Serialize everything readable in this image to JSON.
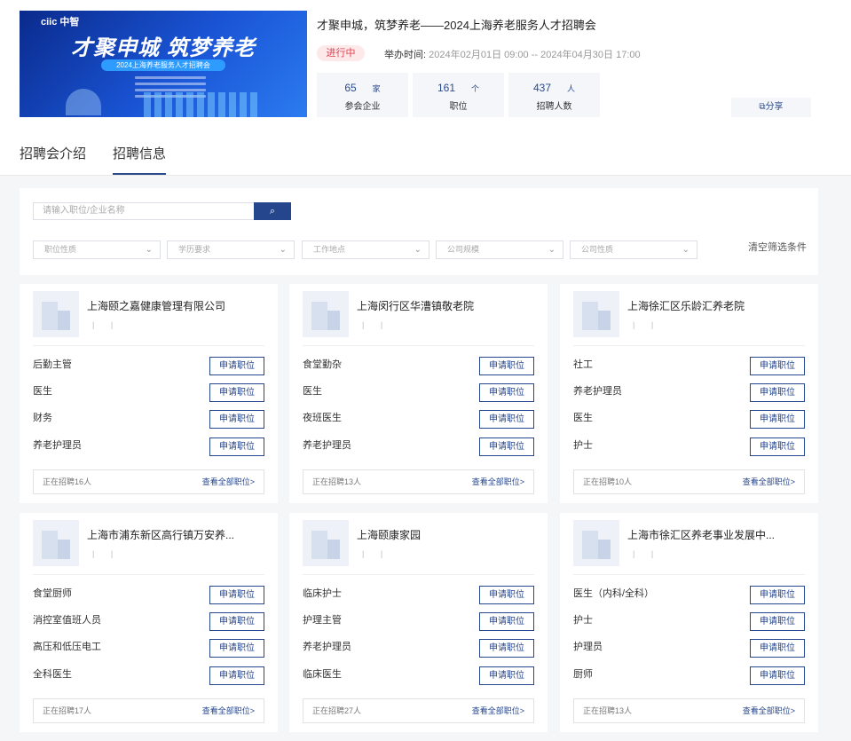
{
  "banner": {
    "logo": "ciic 中智",
    "slogan": "才聚申城 筑梦养老",
    "subtitle": "2024上海养老服务人才招聘会"
  },
  "event": {
    "title": "才聚申城，筑梦养老——2024上海养老服务人才招聘会",
    "status": "进行中",
    "time_label": "举办时间:",
    "time_value": "2024年02月01日 09:00 -- 2024年04月30日 17:00"
  },
  "stats": [
    {
      "value": "65",
      "unit": "家",
      "label": "参会企业"
    },
    {
      "value": "161",
      "unit": "个",
      "label": "职位"
    },
    {
      "value": "437",
      "unit": "人",
      "label": "招聘人数"
    }
  ],
  "share_label": "分享",
  "tabs": [
    {
      "label": "招聘会介绍"
    },
    {
      "label": "招聘信息"
    }
  ],
  "filters": {
    "search_placeholder": "请输入职位/企业名称",
    "selects": [
      "职位性质",
      "学历要求",
      "工作地点",
      "公司规模",
      "公司性质"
    ],
    "clear_label": "清空筛选条件"
  },
  "apply_label": "申请职位",
  "view_all_label": "查看全部职位>",
  "companies": [
    {
      "name": "上海颐之嘉健康管理有限公司",
      "tags": "| |",
      "jobs": [
        "后勤主管",
        "医生",
        "财务",
        "养老护理员"
      ],
      "recruiting": "正在招聘16人"
    },
    {
      "name": "上海闵行区华漕镇敬老院",
      "tags": "| |",
      "jobs": [
        "食堂勤杂",
        "医生",
        "夜班医生",
        "养老护理员"
      ],
      "recruiting": "正在招聘13人"
    },
    {
      "name": "上海徐汇区乐龄汇养老院",
      "tags": "| |",
      "jobs": [
        "社工",
        "养老护理员",
        "医生",
        "护士"
      ],
      "recruiting": "正在招聘10人"
    },
    {
      "name": "上海市浦东新区高行镇万安养...",
      "tags": "| |",
      "jobs": [
        "食堂厨师",
        "消控室值班人员",
        "高压和低压电工",
        "全科医生"
      ],
      "recruiting": "正在招聘17人"
    },
    {
      "name": "上海颐康家园",
      "tags": "| |",
      "jobs": [
        "临床护士",
        "护理主管",
        "养老护理员",
        "临床医生"
      ],
      "recruiting": "正在招聘27人"
    },
    {
      "name": "上海市徐汇区养老事业发展中...",
      "tags": "| |",
      "jobs": [
        "医生（内科/全科）",
        "护士",
        "护理员",
        "厨师"
      ],
      "recruiting": "正在招聘13人"
    }
  ]
}
